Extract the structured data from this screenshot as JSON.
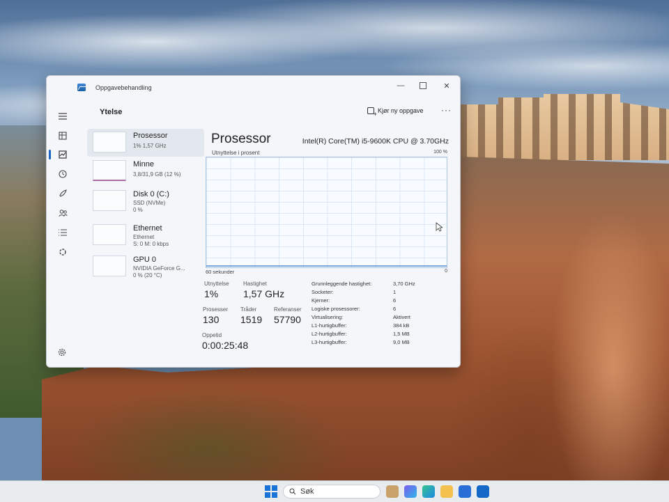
{
  "window": {
    "title": "Oppgavebehandling",
    "controls": {
      "minimize": "—",
      "close": "✕"
    }
  },
  "nav": {
    "items": [
      {
        "name": "menu",
        "icon": "hamburger-icon"
      },
      {
        "name": "processes",
        "icon": "processes-icon"
      },
      {
        "name": "performance",
        "icon": "performance-icon",
        "active": true
      },
      {
        "name": "app-history",
        "icon": "history-icon"
      },
      {
        "name": "startup",
        "icon": "startup-icon"
      },
      {
        "name": "users",
        "icon": "users-icon"
      },
      {
        "name": "details",
        "icon": "details-icon"
      },
      {
        "name": "services",
        "icon": "services-icon"
      }
    ],
    "settings_icon": "settings-icon"
  },
  "header": {
    "title": "Ytelse",
    "run_new_task": "Kjør ny oppgave",
    "more": "···"
  },
  "resources": [
    {
      "name": "Prosessor",
      "line1": "1% 1,57 GHz",
      "selected": true
    },
    {
      "name": "Minne",
      "line1": "3,8/31,9 GB (12 %)"
    },
    {
      "name": "Disk 0 (C:)",
      "line1": "SSD (NVMe)",
      "line2": "0 %"
    },
    {
      "name": "Ethernet",
      "line1": "Ethernet",
      "line2": "S: 0 M: 0 kbps"
    },
    {
      "name": "GPU 0",
      "line1": "NVIDIA GeForce G...",
      "line2": "0 % (20 °C)"
    }
  ],
  "detail": {
    "title": "Prosessor",
    "model": "Intel(R) Core(TM) i5-9600K CPU @ 3.70GHz",
    "graph": {
      "top_left": "Utnyttelse i prosent",
      "top_right": "100 %",
      "bottom_left": "60 sekunder",
      "bottom_right": "0"
    },
    "stats": {
      "utilization_label": "Utnyttelse",
      "utilization_value": "1%",
      "speed_label": "Hastighet",
      "speed_value": "1,57 GHz",
      "processes_label": "Prosesser",
      "processes_value": "130",
      "threads_label": "Tråder",
      "threads_value": "1519",
      "handles_label": "Referanser",
      "handles_value": "57790",
      "uptime_label": "Oppetid",
      "uptime_value": "0:00:25:48"
    },
    "specs": [
      {
        "key": "Grunnleggende hastighet:",
        "value": "3,70 GHz"
      },
      {
        "key": "Socketer:",
        "value": "1"
      },
      {
        "key": "Kjerner:",
        "value": "6"
      },
      {
        "key": "Logiske prosessorer:",
        "value": "6"
      },
      {
        "key": "Virtualisering:",
        "value": "Aktivert"
      },
      {
        "key": "L1-hurtigbuffer:",
        "value": "384 kB"
      },
      {
        "key": "L2-hurtigbuffer:",
        "value": "1,5 MB"
      },
      {
        "key": "L3-hurtigbuffer:",
        "value": "9,0 MB"
      }
    ]
  },
  "taskbar": {
    "search_placeholder": "Søk",
    "start_icon": "windows-start-icon",
    "apps": [
      "file-explorer-icon",
      "copilot-icon",
      "edge-icon",
      "folder-icon",
      "store-icon",
      "outlook-icon"
    ],
    "colors": {
      "start": "#1a73d9"
    }
  }
}
